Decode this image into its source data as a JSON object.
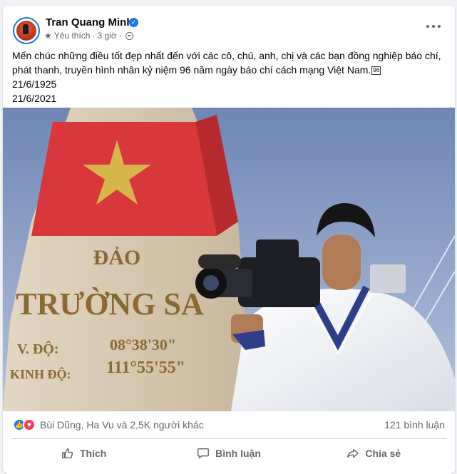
{
  "post": {
    "author_name": "Tran Quang Minh",
    "meta_label": "Yêu thích",
    "meta_separator": "·",
    "meta_time": "3 giờ",
    "meta_separator2": "·",
    "text_lines": [
      "Mến chúc những điều tốt đẹp nhất đến với các cô, chú, anh, chị và các bạn đồng nghiệp báo chí,",
      "phát thanh, truyền hình nhân kỷ niệm 96 năm ngày báo chí cách mạng Việt Nam.",
      "21/6/1925",
      "21/6/2021"
    ],
    "emoji_code": "96",
    "photo_sign": {
      "line1": "ĐẢO",
      "line2": "TRƯỜNG SA",
      "label_a": "V. ĐỘ:",
      "value_a": "08°38'30\"",
      "label_b": "KINH ĐỘ:",
      "value_b": "111°55'55\""
    }
  },
  "engagement": {
    "reactions_text": "Bùi Dũng, Ha Vu và 2,5K người khác",
    "comments_text": "121 bình luận"
  },
  "actions": {
    "like_label": "Thích",
    "comment_label": "Bình luận",
    "share_label": "Chia sẻ"
  },
  "icons": {
    "verified": "verified-badge-icon",
    "star": "star-icon",
    "globe": "globe-icon",
    "more": "more-options-icon",
    "like": "thumbs-up-icon",
    "love": "heart-icon",
    "comment": "comment-bubble-icon",
    "share": "share-arrow-icon"
  },
  "colors": {
    "accent": "#1877f2",
    "love": "#f33e58",
    "secondary_text": "#65676b"
  }
}
